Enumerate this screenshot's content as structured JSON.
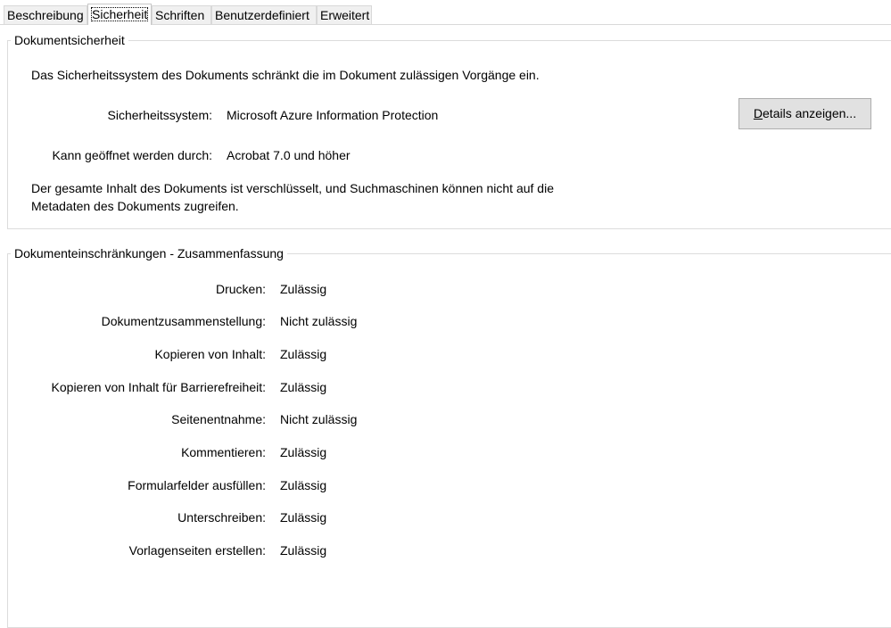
{
  "tabs": [
    {
      "label": "Beschreibung",
      "active": false
    },
    {
      "label": "Sicherheit",
      "active": true
    },
    {
      "label": "Schriften",
      "active": false
    },
    {
      "label": "Benutzerdefiniert",
      "active": false
    },
    {
      "label": "Erweitert",
      "active": false
    }
  ],
  "security_group": {
    "title": "Dokumentsicherheit",
    "intro": "Das Sicherheitssystem des Dokuments schränkt die im Dokument zulässigen Vorgänge ein.",
    "system_label": "Sicherheitssystem:",
    "system_value": "Microsoft Azure Information Protection",
    "opened_by_label": "Kann geöffnet werden durch:",
    "opened_by_value": "Acrobat 7.0 und höher",
    "details_button": {
      "mnemonic": "D",
      "rest": "etails anzeigen..."
    },
    "encryption_note_line1": "Der gesamte Inhalt des Dokuments ist verschlüsselt, und Suchmaschinen können nicht auf die",
    "encryption_note_line2": "Metadaten des Dokuments zugreifen."
  },
  "restrictions_group": {
    "title": "Dokumenteinschränkungen - Zusammenfassung",
    "rows": [
      {
        "label": "Drucken:",
        "value": "Zulässig"
      },
      {
        "label": "Dokumentzusammenstellung:",
        "value": "Nicht zulässig"
      },
      {
        "label": "Kopieren von Inhalt:",
        "value": "Zulässig"
      },
      {
        "label": "Kopieren von Inhalt für Barrierefreiheit:",
        "value": "Zulässig"
      },
      {
        "label": "Seitenentnahme:",
        "value": "Nicht zulässig"
      },
      {
        "label": "Kommentieren:",
        "value": "Zulässig"
      },
      {
        "label": "Formularfelder ausfüllen:",
        "value": "Zulässig"
      },
      {
        "label": "Unterschreiben:",
        "value": "Zulässig"
      },
      {
        "label": "Vorlagenseiten erstellen:",
        "value": "Zulässig"
      }
    ]
  }
}
